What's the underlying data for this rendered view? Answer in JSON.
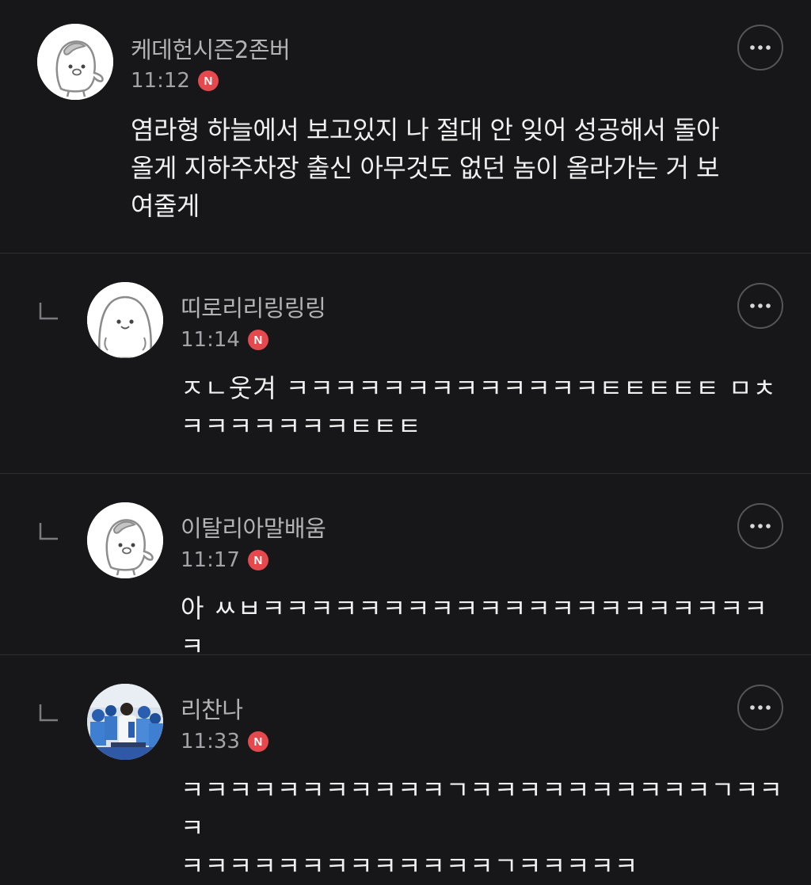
{
  "comments": [
    {
      "author": "케데헌시즌2존버",
      "time": "11:12",
      "badge": "N",
      "is_reply": false,
      "lines": [
        "염라형 하늘에서 보고있지 나 절대 안 잊어 성공해서 돌아",
        "올게 지하주차장 출신 아무것도 없던 놈이 올라가는 거 보",
        "여줄게"
      ],
      "avatar": "penguin-avatar"
    },
    {
      "author": "띠로리리링링링",
      "time": "11:14",
      "badge": "N",
      "is_reply": true,
      "lines": [
        "ㅈㄴ웃겨 ㅋㅋㅋㅋㅋㅋㅋㅋㅋㅋㅋㅋㅋㅌㅌㅌㅌㅌ ㅁㅊ",
        "ㅋㅋㅋㅋㅋㅋㅋㅌㅌㅌ"
      ],
      "avatar": "round-blob-avatar"
    },
    {
      "author": "이탈리아말배움",
      "time": "11:17",
      "badge": "N",
      "is_reply": true,
      "lines": [
        "아 ㅆㅂㅋㅋㅋㅋㅋㅋㅋㅋㅋㅋㅋㅋㅋㅋㅋㅋㅋㅋㅋㅋㅋㅋ"
      ],
      "avatar": "penguin-avatar"
    },
    {
      "author": "리찬나",
      "time": "11:33",
      "badge": "N",
      "is_reply": true,
      "lines": [
        "ㅋㅋㅋㅋㅋㅋㅋㅋㅋㅋㅋㄱㅋㅋㅋㅋㅋㅋㅋㅋㅋㅋㄱㅋㅋㅋ",
        "ㅋㅋㅋㅋㅋㅋㅋㅋㅋㅋㅋㅋㅋㄱㅋㅋㅋㅋㅋ"
      ],
      "avatar": "crowd-photo-avatar"
    }
  ],
  "icons": {
    "more": "more-horizontal-icon",
    "reply": "reply-arrow-icon"
  },
  "colors": {
    "background": "#17171a",
    "badge": "#e5484d",
    "divider": "#2e2e32"
  }
}
